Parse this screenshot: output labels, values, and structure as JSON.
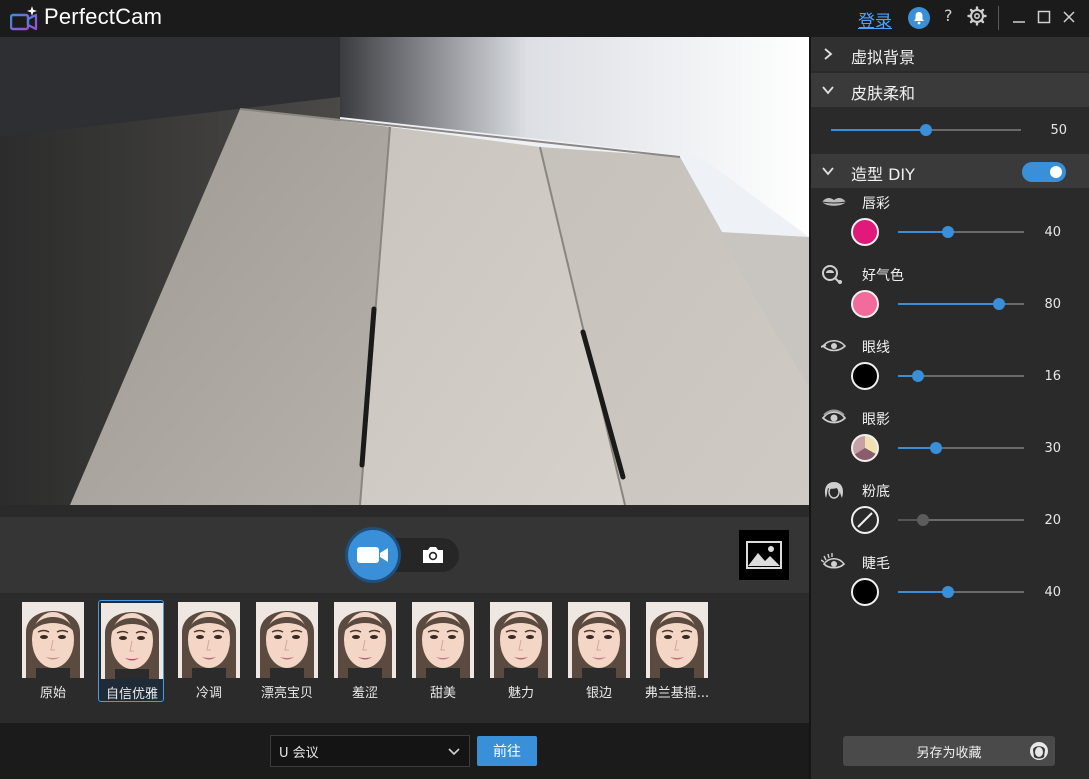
{
  "titlebar": {
    "app_name": "PerfectCam",
    "login": "登录",
    "help": "?"
  },
  "presets": [
    {
      "label": "原始",
      "selected": false
    },
    {
      "label": "自信优雅",
      "selected": true
    },
    {
      "label": "冷调",
      "selected": false
    },
    {
      "label": "漂亮宝贝",
      "selected": false
    },
    {
      "label": "羞涩",
      "selected": false
    },
    {
      "label": "甜美",
      "selected": false
    },
    {
      "label": "魅力",
      "selected": false
    },
    {
      "label": "银边",
      "selected": false
    },
    {
      "label": "弗兰基摇...",
      "selected": false
    }
  ],
  "bottom": {
    "meeting_value": "U 会议",
    "go": "前往"
  },
  "panel": {
    "virtual_bg": "虚拟背景",
    "skin_smooth": "皮肤柔和",
    "skin_value": 50,
    "makeup_diy": "造型 DIY",
    "makeup_enabled": true,
    "features": [
      {
        "label": "唇彩",
        "value": 40,
        "color": "#e0197a",
        "icon": "lips-icon"
      },
      {
        "label": "好气色",
        "value": 80,
        "color": "#f26b9a",
        "icon": "blush-brush-icon"
      },
      {
        "label": "眼线",
        "value": 16,
        "color": "#000000",
        "icon": "eyeliner-icon"
      },
      {
        "label": "眼影",
        "value": 30,
        "color": "multi",
        "icon": "eyeshadow-icon"
      },
      {
        "label": "粉底",
        "value": 20,
        "color": "none",
        "icon": "foundation-icon"
      },
      {
        "label": "睫毛",
        "value": 40,
        "color": "#000000",
        "icon": "eyelash-icon"
      }
    ],
    "save_favorite": "另存为收藏"
  },
  "colors": {
    "accent": "#3a8fd9",
    "panel_bg": "#2a2a2a",
    "header_bg": "#3a3a3a"
  }
}
